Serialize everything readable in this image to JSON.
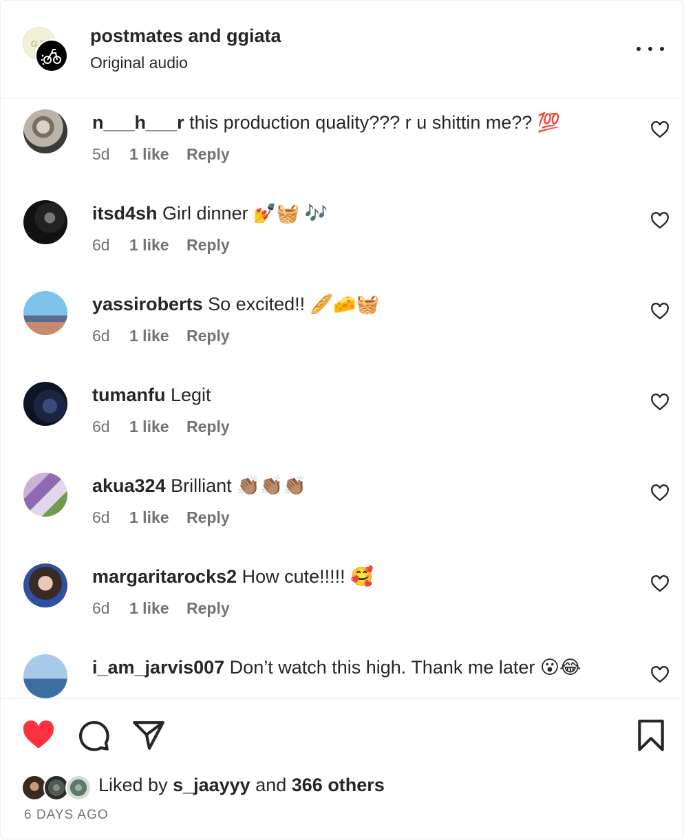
{
  "header": {
    "title": "postmates and ggiata",
    "subtitle": "Original audio",
    "avatar1_text": "GJT"
  },
  "comments": [
    {
      "user": "n___h___r",
      "text": " this production quality??? r u shittin me?? 💯",
      "time": "5d",
      "likes": "1 like",
      "reply": "Reply"
    },
    {
      "user": "itsd4sh",
      "text": " Girl dinner 💅🧺 🎶",
      "time": "6d",
      "likes": "1 like",
      "reply": "Reply"
    },
    {
      "user": "yassiroberts",
      "text": " So excited!! 🥖🧀🧺",
      "time": "6d",
      "likes": "1 like",
      "reply": "Reply"
    },
    {
      "user": "tumanfu",
      "text": " Legit",
      "time": "6d",
      "likes": "1 like",
      "reply": "Reply"
    },
    {
      "user": "akua324",
      "text": " Brilliant 👏🏽👏🏽👏🏽",
      "time": "6d",
      "likes": "1 like",
      "reply": "Reply"
    },
    {
      "user": "margaritarocks2",
      "text": " How cute!!!!! 🥰",
      "time": "6d",
      "likes": "1 like",
      "reply": "Reply"
    },
    {
      "user": "i_am_jarvis007",
      "text": " Don’t watch this high. Thank me later 😮😂",
      "time": "",
      "likes": "",
      "reply": ""
    }
  ],
  "footer": {
    "liked_prefix": "Liked by ",
    "liked_user": "s_jaayyy",
    "liked_mid": " and ",
    "liked_others": "366 others",
    "time_ago": "6 DAYS AGO"
  },
  "colors": {
    "like_red": "#ff3040",
    "muted": "#737373",
    "text": "#262626"
  },
  "icons": {
    "more": "more-horizontal-icon",
    "like": "heart-icon",
    "comment": "comment-icon",
    "share": "share-icon",
    "save": "bookmark-icon"
  }
}
